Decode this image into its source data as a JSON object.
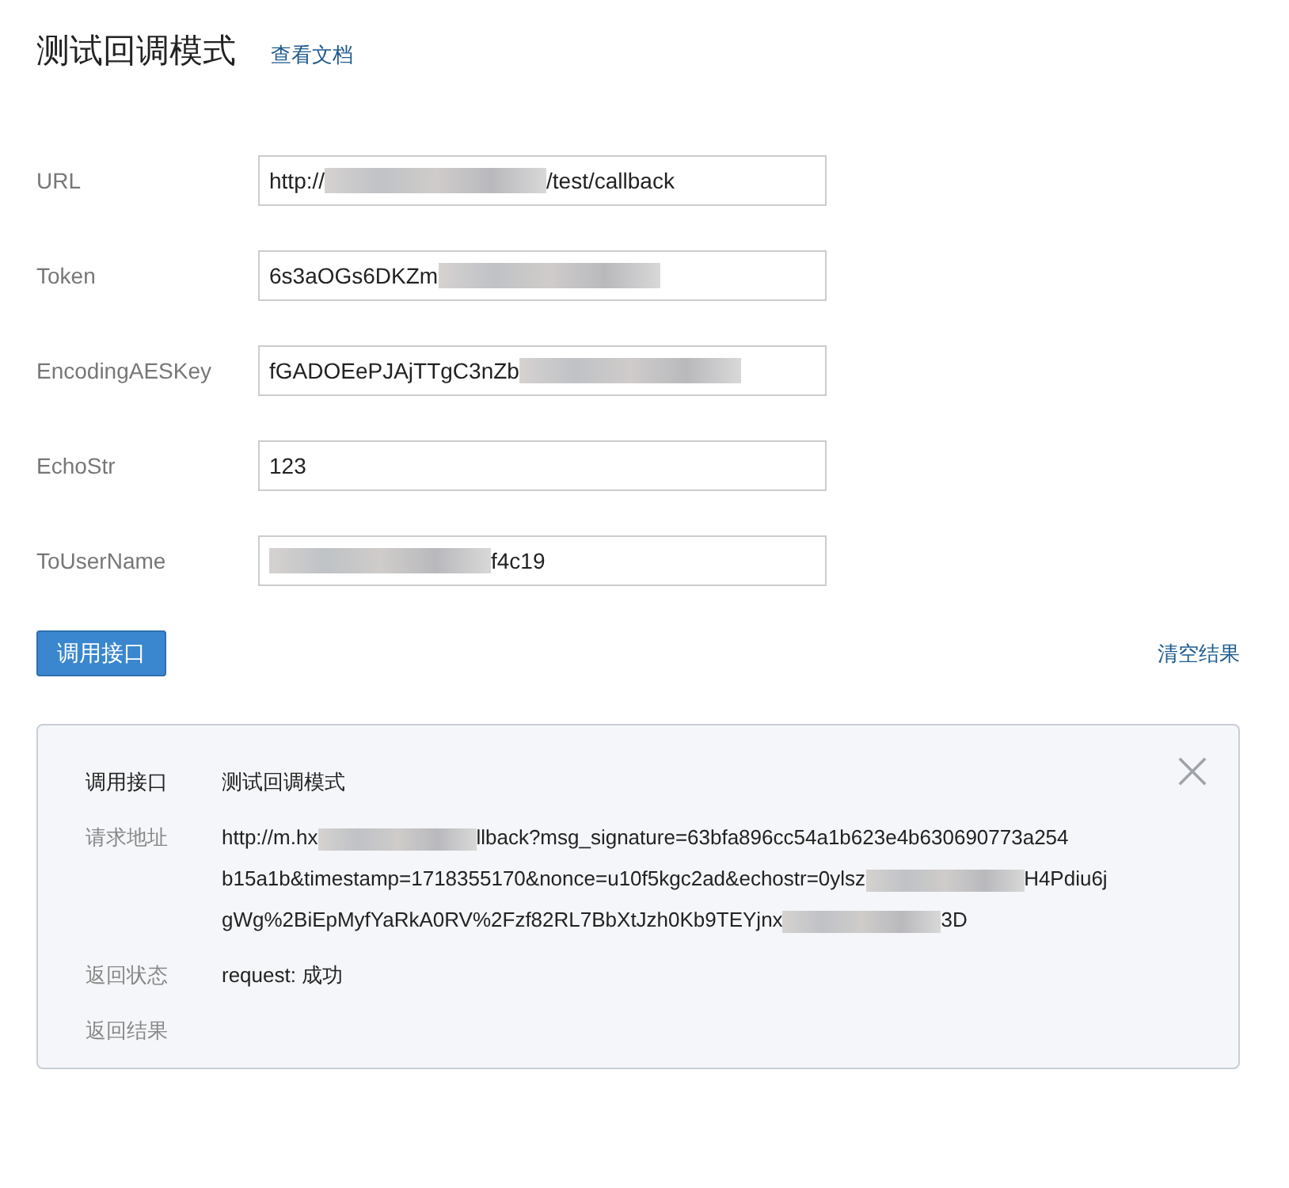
{
  "header": {
    "title": "测试回调模式",
    "doc_link": "查看文档"
  },
  "fields": [
    {
      "label": "URL",
      "value": [
        {
          "kind": "text",
          "text": "http://"
        },
        {
          "kind": "redacted"
        },
        {
          "kind": "text",
          "text": "/test/callback"
        }
      ]
    },
    {
      "label": "Token",
      "value": [
        {
          "kind": "text",
          "text": "6s3aOGs6DKZm"
        },
        {
          "kind": "redacted"
        }
      ]
    },
    {
      "label": "EncodingAESKey",
      "value": [
        {
          "kind": "text",
          "text": "fGADOEePJAjTTgC3nZb"
        },
        {
          "kind": "redacted"
        }
      ]
    },
    {
      "label": "EchoStr",
      "value": [
        {
          "kind": "text",
          "text": "123"
        }
      ]
    },
    {
      "label": "ToUserName",
      "value": [
        {
          "kind": "redacted"
        },
        {
          "kind": "text",
          "text": "f4c19"
        }
      ]
    }
  ],
  "actions": {
    "call_button": "调用接口",
    "clear_link": "清空结果"
  },
  "result": {
    "rows": [
      {
        "kind": "title",
        "label": "调用接口",
        "lines": [
          [
            {
              "kind": "text",
              "text": "测试回调模式"
            }
          ]
        ]
      },
      {
        "kind": "info",
        "label": "请求地址",
        "lines": [
          [
            {
              "kind": "text",
              "text": "http://m.hx"
            },
            {
              "kind": "redacted"
            },
            {
              "kind": "text",
              "text": "llback?msg_signature=63bfa896cc54a1b623e4b630690773a254"
            }
          ],
          [
            {
              "kind": "text",
              "text": "b15a1b&timestamp=1718355170&nonce=u10f5kgc2ad&echostr=0ylsz"
            },
            {
              "kind": "redacted"
            },
            {
              "kind": "text",
              "text": "H4Pdiu6j"
            }
          ],
          [
            {
              "kind": "text",
              "text": "gWg%2BiEpMyfYaRkA0RV%2Fzf82RL7BbXtJzh0Kb9TEYjnx"
            },
            {
              "kind": "redacted"
            },
            {
              "kind": "text",
              "text": "3D"
            }
          ]
        ]
      },
      {
        "kind": "info",
        "label": "返回状态",
        "lines": [
          [
            {
              "kind": "text",
              "text": "request: 成功"
            }
          ]
        ]
      },
      {
        "kind": "info",
        "label": "返回结果"
      }
    ]
  }
}
